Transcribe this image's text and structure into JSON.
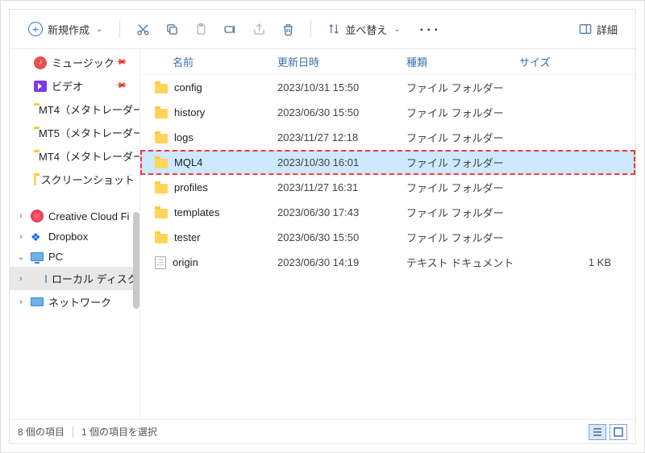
{
  "toolbar": {
    "new_label": "新規作成",
    "sort_label": "並べ替え",
    "details_label": "詳細"
  },
  "sidebar": {
    "items": [
      {
        "label": "ミュージック",
        "icon": "music",
        "pinned": true
      },
      {
        "label": "ビデオ",
        "icon": "video",
        "pinned": true
      },
      {
        "label": "MT4（メタトレーダー",
        "icon": "folder",
        "pinned": false
      },
      {
        "label": "MT5（メタトレーダー",
        "icon": "folder",
        "pinned": false
      },
      {
        "label": "MT4（メタトレーダー",
        "icon": "folder",
        "pinned": false
      },
      {
        "label": "スクリーンショット",
        "icon": "folder",
        "pinned": false
      }
    ],
    "tree": [
      {
        "label": "Creative Cloud Fi",
        "icon": "cc",
        "exp": ">"
      },
      {
        "label": "Dropbox",
        "icon": "dropbox",
        "exp": ">"
      },
      {
        "label": "PC",
        "icon": "pc",
        "exp": "v"
      },
      {
        "label": "ローカル ディスク (",
        "icon": "disk",
        "exp": ">",
        "selected": true,
        "indent": true
      },
      {
        "label": "ネットワーク",
        "icon": "net",
        "exp": ">"
      }
    ]
  },
  "columns": {
    "name": "名前",
    "date": "更新日時",
    "type": "種類",
    "size": "サイズ"
  },
  "files": [
    {
      "name": "config",
      "date": "2023/10/31 15:50",
      "type": "ファイル フォルダー",
      "size": "",
      "icon": "folder"
    },
    {
      "name": "history",
      "date": "2023/06/30 15:50",
      "type": "ファイル フォルダー",
      "size": "",
      "icon": "folder"
    },
    {
      "name": "logs",
      "date": "2023/11/27 12:18",
      "type": "ファイル フォルダー",
      "size": "",
      "icon": "folder"
    },
    {
      "name": "MQL4",
      "date": "2023/10/30 16:01",
      "type": "ファイル フォルダー",
      "size": "",
      "icon": "folder",
      "selected": true
    },
    {
      "name": "profiles",
      "date": "2023/11/27 16:31",
      "type": "ファイル フォルダー",
      "size": "",
      "icon": "folder"
    },
    {
      "name": "templates",
      "date": "2023/06/30 17:43",
      "type": "ファイル フォルダー",
      "size": "",
      "icon": "folder"
    },
    {
      "name": "tester",
      "date": "2023/06/30 15:50",
      "type": "ファイル フォルダー",
      "size": "",
      "icon": "folder"
    },
    {
      "name": "origin",
      "date": "2023/06/30 14:19",
      "type": "テキスト ドキュメント",
      "size": "1 KB",
      "icon": "doc"
    }
  ],
  "status": {
    "item_count": "8 個の項目",
    "selection": "1 個の項目を選択"
  }
}
